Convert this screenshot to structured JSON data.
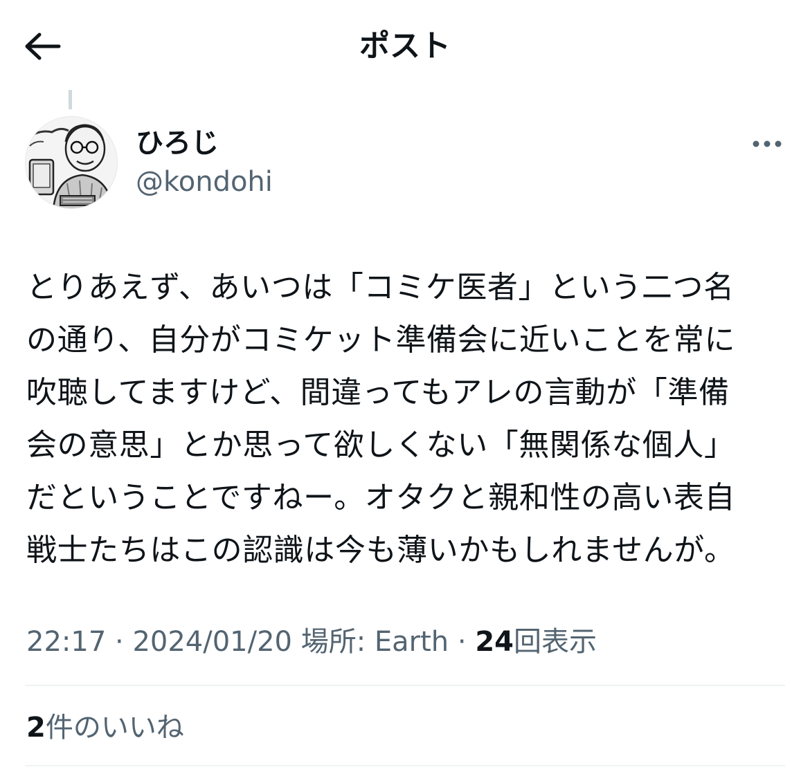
{
  "header": {
    "title": "ポスト",
    "back_icon": "arrow-left-icon"
  },
  "author": {
    "display_name": "ひろじ",
    "handle": "@kondohi",
    "avatar_icon": "cartoon-avatar",
    "more_icon": "more-horizontal-icon"
  },
  "post": {
    "lines": [
      "とりあえず、あいつは「コミケ医者」という二つ名",
      "の通り、自分がコミケット準備会に近いことを常に",
      "吹聴してますけど、間違ってもアレの言動が「準備",
      "会の意思」とか思って欲しくない「無関係な個人」",
      "だということですねー。オタクと親和性の高い表自",
      "戦士たちはこの認識は今も薄いかもしれませんが。"
    ]
  },
  "meta": {
    "time": "22:17",
    "separator": "·",
    "date": "2024/01/20",
    "location": "場所: Earth",
    "views_count": "24",
    "views_label": "回表示"
  },
  "engagement": {
    "likes_count": "2",
    "likes_label": "件のいいね"
  },
  "colors": {
    "text_primary": "#0f1419",
    "text_secondary": "#536471",
    "divider": "#eff3f4",
    "thread_line": "#cfd9de"
  }
}
